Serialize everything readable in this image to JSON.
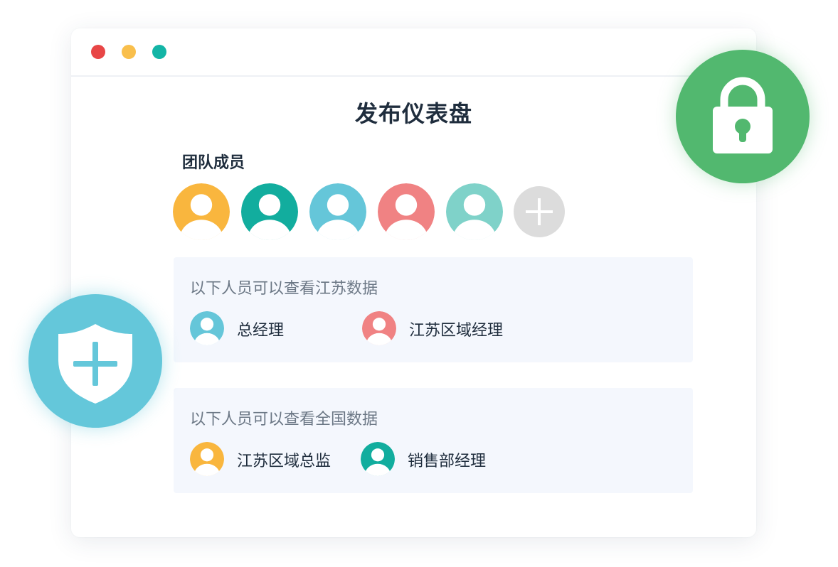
{
  "dialog": {
    "title": "发布仪表盘",
    "window_buttons": [
      "close",
      "minimize",
      "maximize"
    ],
    "window_button_colors": [
      "#e84646",
      "#f9bf4c",
      "#13b5a6"
    ]
  },
  "team": {
    "label": "团队成员",
    "members": [
      {
        "color": "#f9b63e",
        "icon": "user-avatar-icon"
      },
      {
        "color": "#12ad9e",
        "icon": "user-avatar-icon"
      },
      {
        "color": "#65c6d9",
        "icon": "user-avatar-icon"
      },
      {
        "color": "#f08283",
        "icon": "user-avatar-icon"
      },
      {
        "color": "#7fd2c9",
        "icon": "user-avatar-icon"
      }
    ],
    "add_button_icon": "plus-icon",
    "add_button_color": "#dcdcdc"
  },
  "permissions": [
    {
      "title": "以下人员可以查看江苏数据",
      "people": [
        {
          "name": "总经理",
          "color": "#65c6d9"
        },
        {
          "name": "江苏区域经理",
          "color": "#f08283"
        }
      ]
    },
    {
      "title": "以下人员可以查看全国数据",
      "people": [
        {
          "name": "江苏区域总监",
          "color": "#f9b63e"
        },
        {
          "name": "销售部经理",
          "color": "#12ad9e"
        }
      ]
    }
  ],
  "badges": {
    "lock": {
      "icon": "lock-icon",
      "color": "#52b86f"
    },
    "shield": {
      "icon": "shield-plus-icon",
      "color": "#64c7da"
    }
  },
  "panel_background": "#f4f7fd"
}
